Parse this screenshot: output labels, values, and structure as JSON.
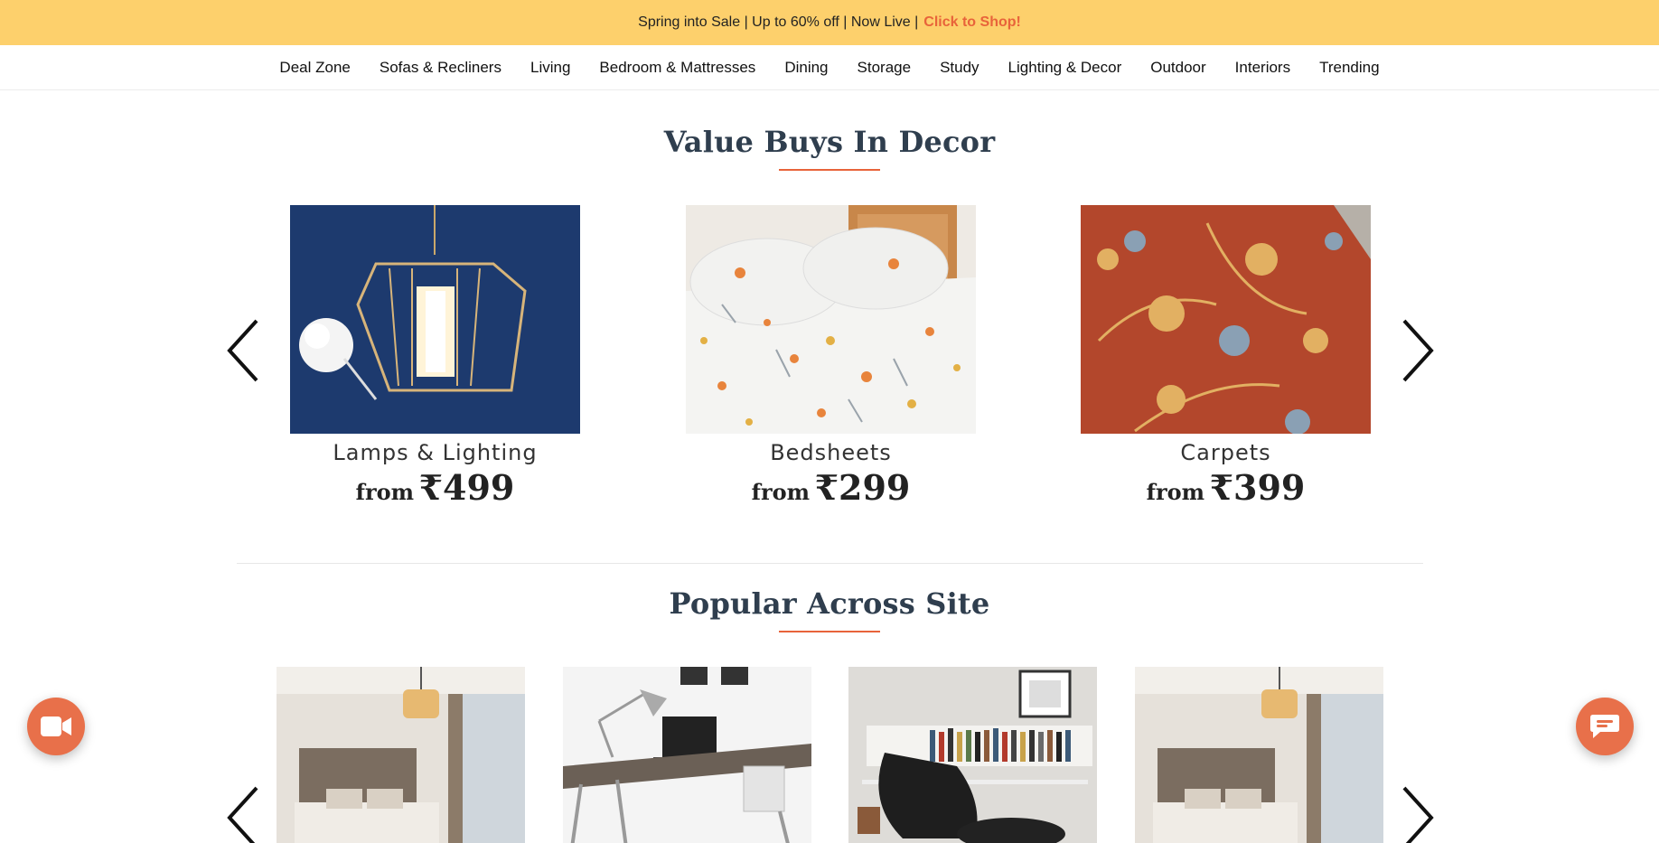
{
  "promo": {
    "text": "Spring into Sale | Up to 60% off | Now Live |",
    "cta": "Click to Shop!"
  },
  "nav": {
    "items": [
      "Deal Zone",
      "Sofas & Recliners",
      "Living",
      "Bedroom & Mattresses",
      "Dining",
      "Storage",
      "Study",
      "Lighting & Decor",
      "Outdoor",
      "Interiors",
      "Trending"
    ]
  },
  "value_buys": {
    "title": "Value Buys In Decor",
    "cards": [
      {
        "name": "Lamps & Lighting",
        "from": "from",
        "price": "₹499"
      },
      {
        "name": "Bedsheets",
        "from": "from",
        "price": "₹299"
      },
      {
        "name": "Carpets",
        "from": "from",
        "price": "₹399"
      }
    ]
  },
  "popular": {
    "title": "Popular Across Site",
    "cards": [
      "bedroom",
      "study-desk",
      "lounge-chair",
      "bedroom"
    ]
  },
  "icons": {
    "prev": "chevron-left-icon",
    "next": "chevron-right-icon",
    "video": "video-camera-icon",
    "chat": "chat-bubble-icon"
  },
  "colors": {
    "promo_bg": "#fdd06c",
    "accent": "#e8633a",
    "title": "#2f3e4e"
  }
}
